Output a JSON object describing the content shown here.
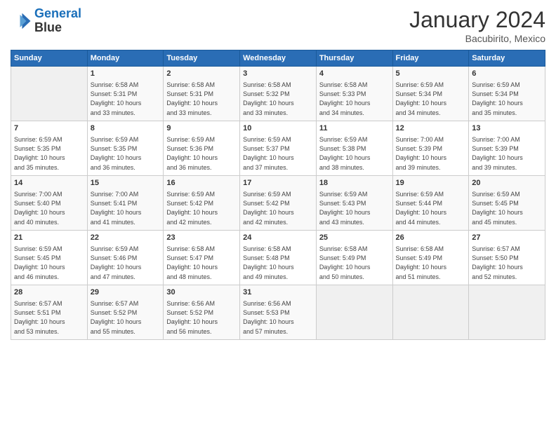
{
  "header": {
    "logo_line1": "General",
    "logo_line2": "Blue",
    "month": "January 2024",
    "location": "Bacubirito, Mexico"
  },
  "weekdays": [
    "Sunday",
    "Monday",
    "Tuesday",
    "Wednesday",
    "Thursday",
    "Friday",
    "Saturday"
  ],
  "weeks": [
    [
      {
        "day": "",
        "info": ""
      },
      {
        "day": "1",
        "info": "Sunrise: 6:58 AM\nSunset: 5:31 PM\nDaylight: 10 hours\nand 33 minutes."
      },
      {
        "day": "2",
        "info": "Sunrise: 6:58 AM\nSunset: 5:31 PM\nDaylight: 10 hours\nand 33 minutes."
      },
      {
        "day": "3",
        "info": "Sunrise: 6:58 AM\nSunset: 5:32 PM\nDaylight: 10 hours\nand 33 minutes."
      },
      {
        "day": "4",
        "info": "Sunrise: 6:58 AM\nSunset: 5:33 PM\nDaylight: 10 hours\nand 34 minutes."
      },
      {
        "day": "5",
        "info": "Sunrise: 6:59 AM\nSunset: 5:34 PM\nDaylight: 10 hours\nand 34 minutes."
      },
      {
        "day": "6",
        "info": "Sunrise: 6:59 AM\nSunset: 5:34 PM\nDaylight: 10 hours\nand 35 minutes."
      }
    ],
    [
      {
        "day": "7",
        "info": "Sunrise: 6:59 AM\nSunset: 5:35 PM\nDaylight: 10 hours\nand 35 minutes."
      },
      {
        "day": "8",
        "info": "Sunrise: 6:59 AM\nSunset: 5:35 PM\nDaylight: 10 hours\nand 36 minutes."
      },
      {
        "day": "9",
        "info": "Sunrise: 6:59 AM\nSunset: 5:36 PM\nDaylight: 10 hours\nand 36 minutes."
      },
      {
        "day": "10",
        "info": "Sunrise: 6:59 AM\nSunset: 5:37 PM\nDaylight: 10 hours\nand 37 minutes."
      },
      {
        "day": "11",
        "info": "Sunrise: 6:59 AM\nSunset: 5:38 PM\nDaylight: 10 hours\nand 38 minutes."
      },
      {
        "day": "12",
        "info": "Sunrise: 7:00 AM\nSunset: 5:39 PM\nDaylight: 10 hours\nand 39 minutes."
      },
      {
        "day": "13",
        "info": "Sunrise: 7:00 AM\nSunset: 5:39 PM\nDaylight: 10 hours\nand 39 minutes."
      }
    ],
    [
      {
        "day": "14",
        "info": "Sunrise: 7:00 AM\nSunset: 5:40 PM\nDaylight: 10 hours\nand 40 minutes."
      },
      {
        "day": "15",
        "info": "Sunrise: 7:00 AM\nSunset: 5:41 PM\nDaylight: 10 hours\nand 41 minutes."
      },
      {
        "day": "16",
        "info": "Sunrise: 6:59 AM\nSunset: 5:42 PM\nDaylight: 10 hours\nand 42 minutes."
      },
      {
        "day": "17",
        "info": "Sunrise: 6:59 AM\nSunset: 5:42 PM\nDaylight: 10 hours\nand 42 minutes."
      },
      {
        "day": "18",
        "info": "Sunrise: 6:59 AM\nSunset: 5:43 PM\nDaylight: 10 hours\nand 43 minutes."
      },
      {
        "day": "19",
        "info": "Sunrise: 6:59 AM\nSunset: 5:44 PM\nDaylight: 10 hours\nand 44 minutes."
      },
      {
        "day": "20",
        "info": "Sunrise: 6:59 AM\nSunset: 5:45 PM\nDaylight: 10 hours\nand 45 minutes."
      }
    ],
    [
      {
        "day": "21",
        "info": "Sunrise: 6:59 AM\nSunset: 5:45 PM\nDaylight: 10 hours\nand 46 minutes."
      },
      {
        "day": "22",
        "info": "Sunrise: 6:59 AM\nSunset: 5:46 PM\nDaylight: 10 hours\nand 47 minutes."
      },
      {
        "day": "23",
        "info": "Sunrise: 6:58 AM\nSunset: 5:47 PM\nDaylight: 10 hours\nand 48 minutes."
      },
      {
        "day": "24",
        "info": "Sunrise: 6:58 AM\nSunset: 5:48 PM\nDaylight: 10 hours\nand 49 minutes."
      },
      {
        "day": "25",
        "info": "Sunrise: 6:58 AM\nSunset: 5:49 PM\nDaylight: 10 hours\nand 50 minutes."
      },
      {
        "day": "26",
        "info": "Sunrise: 6:58 AM\nSunset: 5:49 PM\nDaylight: 10 hours\nand 51 minutes."
      },
      {
        "day": "27",
        "info": "Sunrise: 6:57 AM\nSunset: 5:50 PM\nDaylight: 10 hours\nand 52 minutes."
      }
    ],
    [
      {
        "day": "28",
        "info": "Sunrise: 6:57 AM\nSunset: 5:51 PM\nDaylight: 10 hours\nand 53 minutes."
      },
      {
        "day": "29",
        "info": "Sunrise: 6:57 AM\nSunset: 5:52 PM\nDaylight: 10 hours\nand 55 minutes."
      },
      {
        "day": "30",
        "info": "Sunrise: 6:56 AM\nSunset: 5:52 PM\nDaylight: 10 hours\nand 56 minutes."
      },
      {
        "day": "31",
        "info": "Sunrise: 6:56 AM\nSunset: 5:53 PM\nDaylight: 10 hours\nand 57 minutes."
      },
      {
        "day": "",
        "info": ""
      },
      {
        "day": "",
        "info": ""
      },
      {
        "day": "",
        "info": ""
      }
    ]
  ]
}
